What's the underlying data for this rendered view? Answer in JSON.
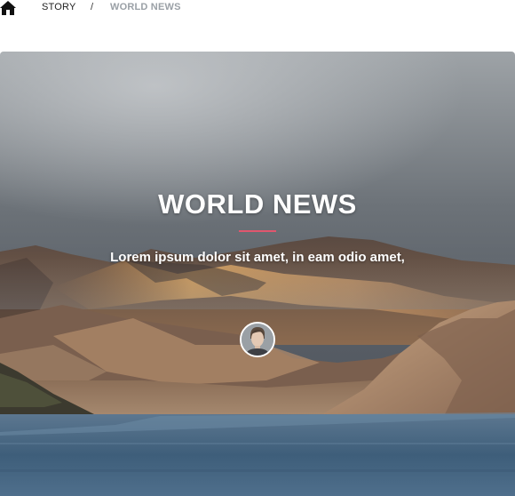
{
  "breadcrumb": {
    "home_icon": "home-icon",
    "items": [
      "STORY"
    ],
    "separator": "/",
    "current": "WORLD NEWS"
  },
  "hero": {
    "title": "WORLD NEWS",
    "subtitle": "Lorem ipsum dolor sit amet, in eam odio amet,",
    "accent_color": "#e0566e",
    "avatar_icon": "author-avatar"
  }
}
